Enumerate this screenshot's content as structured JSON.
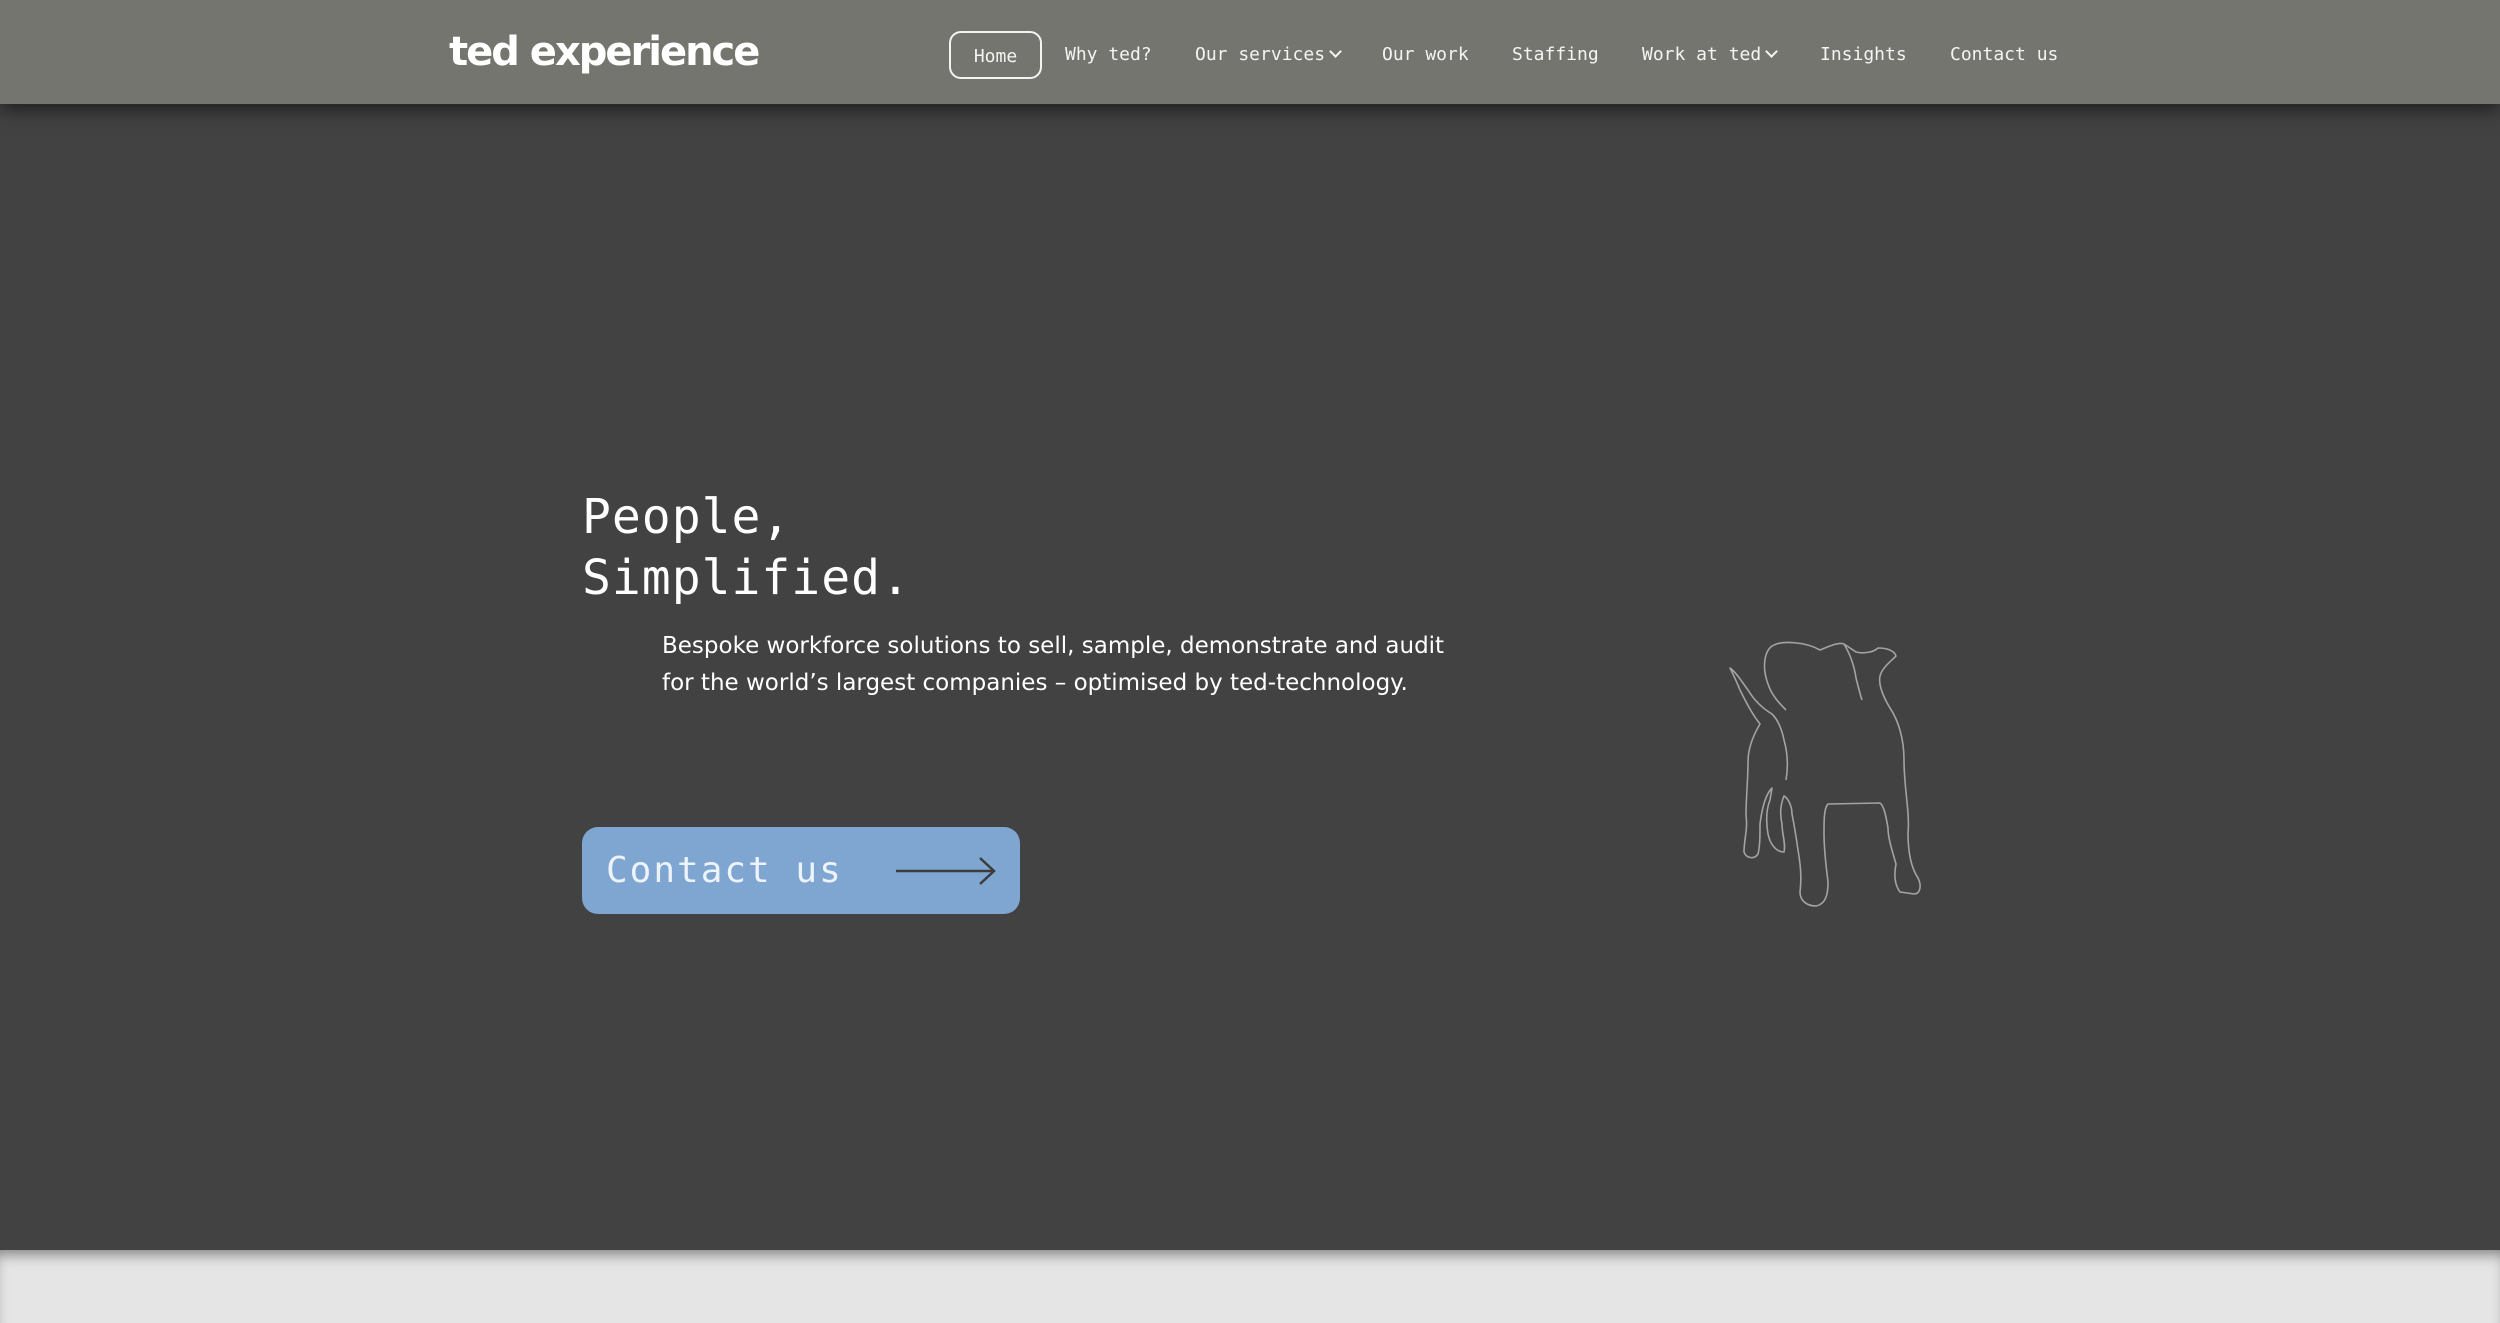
{
  "brand": {
    "logo_text": "ted experience"
  },
  "nav": {
    "items": [
      {
        "label": "Home",
        "active": true
      },
      {
        "label": "Why ted?"
      },
      {
        "label": "Our services",
        "has_dropdown": true
      },
      {
        "label": "Our work"
      },
      {
        "label": "Staffing"
      },
      {
        "label": "Work at ted",
        "has_dropdown": true
      },
      {
        "label": "Insights"
      },
      {
        "label": "Contact us"
      }
    ]
  },
  "hero": {
    "headline_line1": "People,",
    "headline_line2": "Simplified.",
    "subtext": "Bespoke workforce solutions to sell, sample, demonstrate and audit for the world’s largest companies – optimised by ted-technology.",
    "cta_label": "Contact us"
  },
  "icons": {
    "cta_arrow": "arrow-right-icon",
    "illustration": "dog-outline-icon",
    "dropdown": "chevron-down-icon"
  },
  "colors": {
    "header_bg": "#74756f",
    "hero_bg": "#424242",
    "cta_bg": "#7ea6d1",
    "footer_bg": "#e5e5e5",
    "text": "#ffffff"
  }
}
